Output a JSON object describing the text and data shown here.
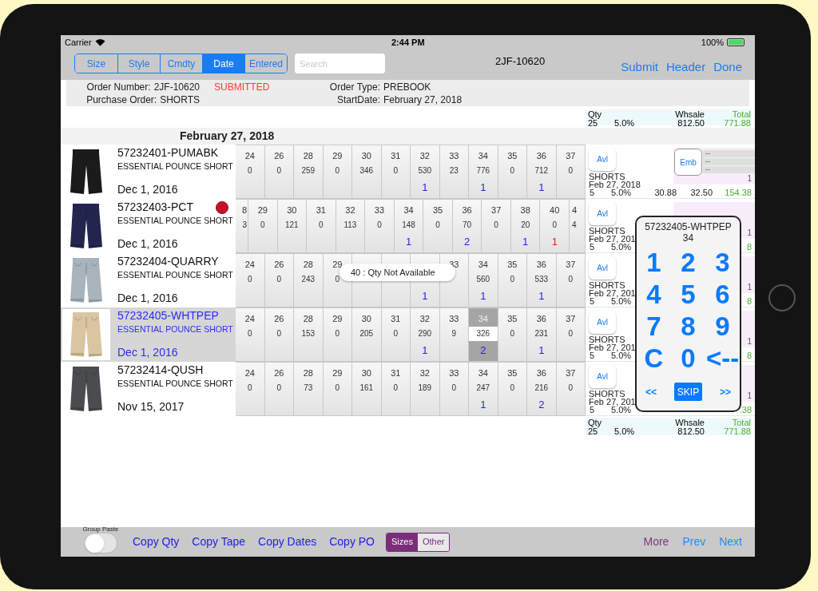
{
  "status_bar": {
    "carrier": "Carrier",
    "time": "2:44 PM",
    "battery": "100%"
  },
  "nav": {
    "segments": [
      {
        "label": "Size",
        "selected": false
      },
      {
        "label": "Style",
        "selected": false
      },
      {
        "label": "Cmdty",
        "selected": false
      },
      {
        "label": "Date",
        "selected": true
      },
      {
        "label": "Entered",
        "selected": false
      }
    ],
    "search": {
      "placeholder": "Search"
    },
    "title": "2JF-10620",
    "actions": [
      "Submit",
      "Header",
      "Done"
    ]
  },
  "order_info": {
    "order_number_label": "Order Number:",
    "order_number": "2JF-10620",
    "status": "SUBMITTED",
    "order_type_label": "Order Type:",
    "order_type": "PREBOOK",
    "po_label": "Purchase Order:",
    "po": "SHORTS",
    "start_label": "StartDate:",
    "start_date": "February 27, 2018"
  },
  "summary_top": {
    "qty_label": "Qty",
    "qty": "25",
    "discount": "5.0%",
    "whsale_label": "Whsale",
    "whsale": "812.50",
    "total_label": "Total",
    "total": "771.88"
  },
  "date_header": "February 27, 2018",
  "rows": [
    {
      "style": "57232401-PUMABK",
      "description": "ESSENTIAL POUNCE SHORT",
      "date": "Dec 1, 2016",
      "selected": false,
      "swiped": false,
      "cells": [
        {
          "size": "24",
          "avail": "0",
          "selected": false
        },
        {
          "size": "26",
          "avail": "0",
          "selected": false
        },
        {
          "size": "28",
          "avail": "259",
          "selected": false
        },
        {
          "size": "29",
          "avail": "0",
          "selected": false
        },
        {
          "size": "30",
          "avail": "346",
          "selected": false
        },
        {
          "size": "31",
          "avail": "0",
          "selected": false
        },
        {
          "size": "32",
          "avail": "530",
          "qty": "1",
          "color": "#2424e0",
          "selected": false
        },
        {
          "size": "33",
          "avail": "23",
          "selected": false
        },
        {
          "size": "34",
          "avail": "776",
          "qty": "1",
          "color": "#2424e0",
          "selected": false
        },
        {
          "size": "35",
          "avail": "0",
          "selected": false
        },
        {
          "size": "36",
          "avail": "712",
          "qty": "1",
          "color": "#2424e0",
          "selected": false
        },
        {
          "size": "37",
          "avail": "0",
          "selected": false
        }
      ],
      "side": {
        "avl": "Avl",
        "emb": "Emb",
        "dashes": [
          "--",
          "--",
          "--"
        ],
        "badge": "1",
        "category": "SHORTS",
        "date": "Feb 27, 2018",
        "qty": "5",
        "discount": "5.0%",
        "price": "30.88",
        "whsale": "32.50",
        "total": "154.38"
      }
    },
    {
      "style": "57232403-PCT",
      "description": "ESSENTIAL POUNCE SHORT",
      "date": "Dec 1, 2016",
      "selected": false,
      "swiped": true,
      "cells": [
        {
          "size": "8",
          "avail": "3",
          "selected": false
        },
        {
          "size": "29",
          "avail": "0",
          "selected": false
        },
        {
          "size": "30",
          "avail": "121",
          "selected": false
        },
        {
          "size": "31",
          "avail": "0",
          "selected": false
        },
        {
          "size": "32",
          "avail": "113",
          "selected": false
        },
        {
          "size": "33",
          "avail": "0",
          "selected": false
        },
        {
          "size": "34",
          "avail": "148",
          "qty": "1",
          "color": "#2424e0",
          "selected": false
        },
        {
          "size": "35",
          "avail": "0",
          "selected": false
        },
        {
          "size": "36",
          "avail": "70",
          "qty": "2",
          "color": "#2424e0",
          "selected": false
        },
        {
          "size": "37",
          "avail": "0",
          "selected": false
        },
        {
          "size": "38",
          "avail": "20",
          "qty": "1",
          "color": "#2424e0",
          "selected": false
        },
        {
          "size": "40",
          "avail": "0",
          "qty": "1",
          "color": "#e0201a",
          "selected": false
        },
        {
          "size": "4",
          "avail": "4",
          "selected": false
        }
      ],
      "side": {
        "avl": "Avl",
        "badge": "1",
        "category": "SHORTS",
        "date": "Feb 27, 201",
        "qty": "5",
        "discount": "5.0%",
        "total": "8"
      }
    },
    {
      "style": "57232404-QUARRY",
      "description": "ESSENTIAL POUNCE SHORT",
      "date": "Dec 1, 2016",
      "selected": false,
      "swiped": false,
      "cells": [
        {
          "size": "24",
          "avail": "0",
          "selected": false
        },
        {
          "size": "26",
          "avail": "0",
          "selected": false
        },
        {
          "size": "28",
          "avail": "243",
          "selected": false
        },
        {
          "size": "29",
          "avail": "0",
          "selected": false
        },
        {
          "selected": false
        },
        {
          "selected": false
        },
        {
          "qty": "1",
          "color": "#2424e0",
          "selected": false
        },
        {
          "size": "33",
          "selected": false
        },
        {
          "size": "34",
          "avail": "560",
          "qty": "1",
          "color": "#2424e0",
          "selected": false
        },
        {
          "size": "35",
          "avail": "0",
          "selected": false
        },
        {
          "size": "36",
          "avail": "533",
          "qty": "1",
          "color": "#2424e0",
          "selected": false
        },
        {
          "size": "37",
          "avail": "0",
          "selected": false
        }
      ],
      "side": {
        "avl": "Avl",
        "badge": "1",
        "category": "SHORTS",
        "date": "Feb 27, 201",
        "qty": "5",
        "discount": "5.0%",
        "total": "8"
      }
    },
    {
      "style": "57232405-WHTPEP",
      "description": "ESSENTIAL POUNCE SHORT",
      "date": "Dec 1, 2016",
      "selected": true,
      "swiped": false,
      "cells": [
        {
          "size": "24",
          "avail": "0",
          "selected": false
        },
        {
          "size": "26",
          "avail": "0",
          "selected": false
        },
        {
          "size": "28",
          "avail": "153",
          "selected": false
        },
        {
          "size": "29",
          "avail": "0",
          "selected": false
        },
        {
          "size": "30",
          "avail": "205",
          "selected": false
        },
        {
          "size": "31",
          "avail": "0",
          "selected": false
        },
        {
          "size": "32",
          "avail": "290",
          "qty": "1",
          "color": "#2424e0",
          "selected": false
        },
        {
          "size": "33",
          "avail": "9",
          "selected": false
        },
        {
          "size": "34",
          "avail": "326",
          "qty": "2",
          "color": "#2424e0",
          "selected": true
        },
        {
          "size": "35",
          "avail": "0",
          "selected": false
        },
        {
          "size": "36",
          "avail": "231",
          "qty": "1",
          "color": "#2424e0",
          "selected": false
        },
        {
          "size": "37",
          "avail": "0",
          "selected": false
        }
      ],
      "side": {
        "avl": "Avl",
        "badge": "1",
        "category": "SHORTS",
        "date": "Feb 27, 201",
        "qty": "5",
        "discount": "5.0%",
        "total": "8"
      }
    },
    {
      "style": "57232414-QUSH",
      "description": "ESSENTIAL POUNCE SHORT",
      "date": "Nov 15, 2017",
      "selected": false,
      "swiped": false,
      "cells": [
        {
          "size": "24",
          "avail": "0",
          "selected": false
        },
        {
          "size": "26",
          "avail": "0",
          "selected": false
        },
        {
          "size": "28",
          "avail": "73",
          "selected": false
        },
        {
          "size": "29",
          "avail": "0",
          "selected": false
        },
        {
          "size": "30",
          "avail": "161",
          "selected": false
        },
        {
          "size": "31",
          "avail": "0",
          "selected": false
        },
        {
          "size": "32",
          "avail": "189",
          "selected": false
        },
        {
          "size": "33",
          "avail": "0",
          "selected": false
        },
        {
          "size": "34",
          "avail": "247",
          "qty": "1",
          "color": "#2424e0",
          "selected": false
        },
        {
          "size": "35",
          "avail": "0",
          "selected": false
        },
        {
          "size": "36",
          "avail": "216",
          "qty": "2",
          "color": "#2424e0",
          "selected": false
        },
        {
          "size": "37",
          "avail": "0",
          "selected": false
        }
      ],
      "side": {
        "avl": "Avl",
        "badge": "1",
        "category": "SHORTS",
        "date": "Feb 27, 201",
        "qty": "5",
        "discount": "5.0%",
        "total": ".38"
      }
    }
  ],
  "summary_bottom": {
    "qty_label": "Qty",
    "qty": "25",
    "discount": "5.0%",
    "whsale_label": "Whsale",
    "whsale": "812.50",
    "total_label": "Total",
    "total": "771.88"
  },
  "tooltip": "40 : Qty Not Available",
  "keypad": {
    "title": "57232405-WHTPEP",
    "size": "34",
    "keys": [
      "1",
      "2",
      "3",
      "4",
      "5",
      "6",
      "7",
      "8",
      "9",
      "C",
      "0",
      "<--"
    ],
    "prev": "<<",
    "skip": "SKIP",
    "next": ">>"
  },
  "toolbar": {
    "group_paste_label": "Group Paste",
    "group_paste_on": false,
    "buttons": [
      "Copy Qty",
      "Copy Tape",
      "Copy Dates",
      "Copy PO"
    ],
    "segments": [
      {
        "label": "Sizes",
        "selected": true
      },
      {
        "label": "Other",
        "selected": false
      }
    ],
    "more": "More",
    "prev": "Prev",
    "next": "Next"
  }
}
